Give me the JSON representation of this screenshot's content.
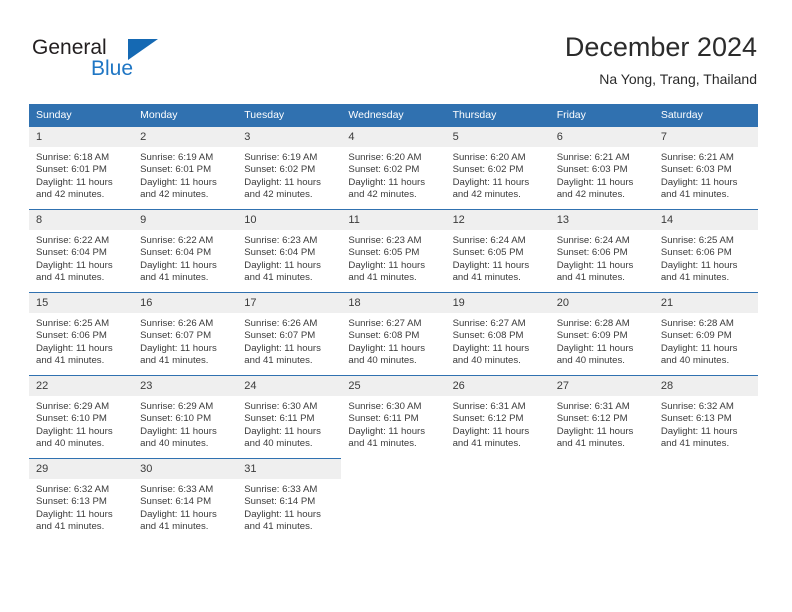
{
  "brand": {
    "name_part1": "General",
    "name_part2": "Blue",
    "logo_icon": "triangle-flag-icon",
    "accent_color": "#1569b3"
  },
  "header": {
    "title": "December 2024",
    "subtitle": "Na Yong, Trang, Thailand"
  },
  "calendar": {
    "header_background": "#3071b0",
    "daynum_background": "#efefef",
    "weekday_headers": [
      "Sunday",
      "Monday",
      "Tuesday",
      "Wednesday",
      "Thursday",
      "Friday",
      "Saturday"
    ],
    "weeks": [
      [
        {
          "day": "1",
          "sunrise": "Sunrise: 6:18 AM",
          "sunset": "Sunset: 6:01 PM",
          "daylight": "Daylight: 11 hours and 42 minutes."
        },
        {
          "day": "2",
          "sunrise": "Sunrise: 6:19 AM",
          "sunset": "Sunset: 6:01 PM",
          "daylight": "Daylight: 11 hours and 42 minutes."
        },
        {
          "day": "3",
          "sunrise": "Sunrise: 6:19 AM",
          "sunset": "Sunset: 6:02 PM",
          "daylight": "Daylight: 11 hours and 42 minutes."
        },
        {
          "day": "4",
          "sunrise": "Sunrise: 6:20 AM",
          "sunset": "Sunset: 6:02 PM",
          "daylight": "Daylight: 11 hours and 42 minutes."
        },
        {
          "day": "5",
          "sunrise": "Sunrise: 6:20 AM",
          "sunset": "Sunset: 6:02 PM",
          "daylight": "Daylight: 11 hours and 42 minutes."
        },
        {
          "day": "6",
          "sunrise": "Sunrise: 6:21 AM",
          "sunset": "Sunset: 6:03 PM",
          "daylight": "Daylight: 11 hours and 42 minutes."
        },
        {
          "day": "7",
          "sunrise": "Sunrise: 6:21 AM",
          "sunset": "Sunset: 6:03 PM",
          "daylight": "Daylight: 11 hours and 41 minutes."
        }
      ],
      [
        {
          "day": "8",
          "sunrise": "Sunrise: 6:22 AM",
          "sunset": "Sunset: 6:04 PM",
          "daylight": "Daylight: 11 hours and 41 minutes."
        },
        {
          "day": "9",
          "sunrise": "Sunrise: 6:22 AM",
          "sunset": "Sunset: 6:04 PM",
          "daylight": "Daylight: 11 hours and 41 minutes."
        },
        {
          "day": "10",
          "sunrise": "Sunrise: 6:23 AM",
          "sunset": "Sunset: 6:04 PM",
          "daylight": "Daylight: 11 hours and 41 minutes."
        },
        {
          "day": "11",
          "sunrise": "Sunrise: 6:23 AM",
          "sunset": "Sunset: 6:05 PM",
          "daylight": "Daylight: 11 hours and 41 minutes."
        },
        {
          "day": "12",
          "sunrise": "Sunrise: 6:24 AM",
          "sunset": "Sunset: 6:05 PM",
          "daylight": "Daylight: 11 hours and 41 minutes."
        },
        {
          "day": "13",
          "sunrise": "Sunrise: 6:24 AM",
          "sunset": "Sunset: 6:06 PM",
          "daylight": "Daylight: 11 hours and 41 minutes."
        },
        {
          "day": "14",
          "sunrise": "Sunrise: 6:25 AM",
          "sunset": "Sunset: 6:06 PM",
          "daylight": "Daylight: 11 hours and 41 minutes."
        }
      ],
      [
        {
          "day": "15",
          "sunrise": "Sunrise: 6:25 AM",
          "sunset": "Sunset: 6:06 PM",
          "daylight": "Daylight: 11 hours and 41 minutes."
        },
        {
          "day": "16",
          "sunrise": "Sunrise: 6:26 AM",
          "sunset": "Sunset: 6:07 PM",
          "daylight": "Daylight: 11 hours and 41 minutes."
        },
        {
          "day": "17",
          "sunrise": "Sunrise: 6:26 AM",
          "sunset": "Sunset: 6:07 PM",
          "daylight": "Daylight: 11 hours and 41 minutes."
        },
        {
          "day": "18",
          "sunrise": "Sunrise: 6:27 AM",
          "sunset": "Sunset: 6:08 PM",
          "daylight": "Daylight: 11 hours and 40 minutes."
        },
        {
          "day": "19",
          "sunrise": "Sunrise: 6:27 AM",
          "sunset": "Sunset: 6:08 PM",
          "daylight": "Daylight: 11 hours and 40 minutes."
        },
        {
          "day": "20",
          "sunrise": "Sunrise: 6:28 AM",
          "sunset": "Sunset: 6:09 PM",
          "daylight": "Daylight: 11 hours and 40 minutes."
        },
        {
          "day": "21",
          "sunrise": "Sunrise: 6:28 AM",
          "sunset": "Sunset: 6:09 PM",
          "daylight": "Daylight: 11 hours and 40 minutes."
        }
      ],
      [
        {
          "day": "22",
          "sunrise": "Sunrise: 6:29 AM",
          "sunset": "Sunset: 6:10 PM",
          "daylight": "Daylight: 11 hours and 40 minutes."
        },
        {
          "day": "23",
          "sunrise": "Sunrise: 6:29 AM",
          "sunset": "Sunset: 6:10 PM",
          "daylight": "Daylight: 11 hours and 40 minutes."
        },
        {
          "day": "24",
          "sunrise": "Sunrise: 6:30 AM",
          "sunset": "Sunset: 6:11 PM",
          "daylight": "Daylight: 11 hours and 40 minutes."
        },
        {
          "day": "25",
          "sunrise": "Sunrise: 6:30 AM",
          "sunset": "Sunset: 6:11 PM",
          "daylight": "Daylight: 11 hours and 41 minutes."
        },
        {
          "day": "26",
          "sunrise": "Sunrise: 6:31 AM",
          "sunset": "Sunset: 6:12 PM",
          "daylight": "Daylight: 11 hours and 41 minutes."
        },
        {
          "day": "27",
          "sunrise": "Sunrise: 6:31 AM",
          "sunset": "Sunset: 6:12 PM",
          "daylight": "Daylight: 11 hours and 41 minutes."
        },
        {
          "day": "28",
          "sunrise": "Sunrise: 6:32 AM",
          "sunset": "Sunset: 6:13 PM",
          "daylight": "Daylight: 11 hours and 41 minutes."
        }
      ],
      [
        {
          "day": "29",
          "sunrise": "Sunrise: 6:32 AM",
          "sunset": "Sunset: 6:13 PM",
          "daylight": "Daylight: 11 hours and 41 minutes."
        },
        {
          "day": "30",
          "sunrise": "Sunrise: 6:33 AM",
          "sunset": "Sunset: 6:14 PM",
          "daylight": "Daylight: 11 hours and 41 minutes."
        },
        {
          "day": "31",
          "sunrise": "Sunrise: 6:33 AM",
          "sunset": "Sunset: 6:14 PM",
          "daylight": "Daylight: 11 hours and 41 minutes."
        },
        {
          "day": "",
          "sunrise": "",
          "sunset": "",
          "daylight": ""
        },
        {
          "day": "",
          "sunrise": "",
          "sunset": "",
          "daylight": ""
        },
        {
          "day": "",
          "sunrise": "",
          "sunset": "",
          "daylight": ""
        },
        {
          "day": "",
          "sunrise": "",
          "sunset": "",
          "daylight": ""
        }
      ]
    ]
  }
}
